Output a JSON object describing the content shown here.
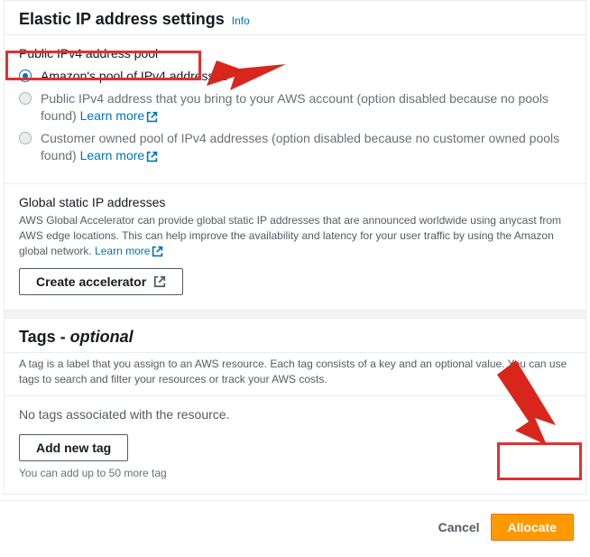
{
  "eip": {
    "title": "Elastic IP address settings",
    "info": "Info",
    "pool_group_label": "Public IPv4 address pool",
    "options": [
      {
        "label": "Amazon's pool of IPv4 addresses"
      },
      {
        "label_prefix": "Public IPv4 address that you bring to your AWS account (option disabled because no pools found) ",
        "learn": "Learn more"
      },
      {
        "label_prefix": "Customer owned pool of IPv4 addresses (option disabled because no customer owned pools found) ",
        "learn": "Learn more"
      }
    ]
  },
  "global": {
    "heading": "Global static IP addresses",
    "desc_prefix": "AWS Global Accelerator can provide global static IP addresses that are announced worldwide using anycast from AWS edge locations. This can help improve the availability and latency for your user traffic by using the Amazon global network. ",
    "learn": "Learn more",
    "create_btn": "Create accelerator"
  },
  "tags": {
    "heading": "Tags - ",
    "optional": "optional",
    "desc": "A tag is a label that you assign to an AWS resource. Each tag consists of a key and an optional value. You can use tags to search and filter your resources or track your AWS costs.",
    "empty": "No tags associated with the resource.",
    "add_btn": "Add new tag",
    "note": "You can add up to 50 more tag"
  },
  "footer": {
    "cancel": "Cancel",
    "allocate": "Allocate"
  }
}
